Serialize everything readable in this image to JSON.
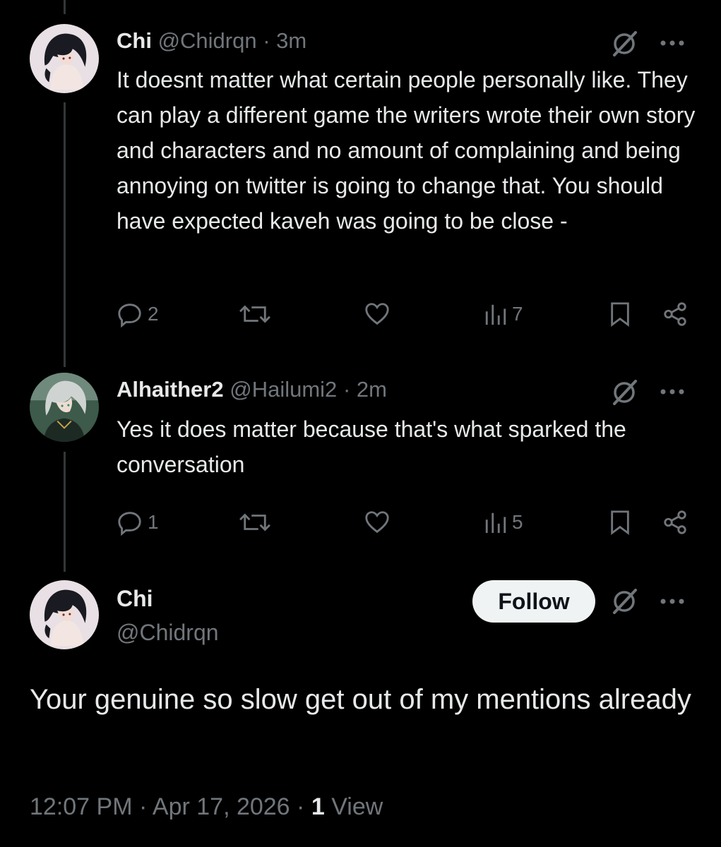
{
  "replies": [
    {
      "name": "Chi",
      "handle": "@Chidrqn",
      "separator": "·",
      "time": "3m",
      "text": "It doesnt matter what certain people personally like. They can play a different game the writers wrote their own story and characters and no amount of complaining and being annoying on twitter is going to change that. You should have expected kaveh was going to be close -",
      "reply_count": "2",
      "views": "7",
      "icons": [
        "reply-icon",
        "retweet-icon",
        "like-icon",
        "views-icon",
        "bookmark-icon",
        "share-icon",
        "grok-icon",
        "more-icon"
      ]
    },
    {
      "name": "Alhaither2",
      "handle": "@Hailumi2",
      "separator": "·",
      "time": "2m",
      "text": "Yes it does matter because that's what sparked the conversation",
      "reply_count": "1",
      "views": "5",
      "icons": [
        "reply-icon",
        "retweet-icon",
        "like-icon",
        "views-icon",
        "bookmark-icon",
        "share-icon",
        "grok-icon",
        "more-icon"
      ]
    }
  ],
  "main_tweet": {
    "name": "Chi",
    "handle": "@Chidrqn",
    "follow_label": "Follow",
    "text": "Your genuine so slow get out of my mentions already",
    "time": "12:07 PM",
    "separator": "·",
    "date": "Apr 17, 2026",
    "views_count": "1",
    "views_label": "View"
  },
  "colors": {
    "background": "#000000",
    "text": "#e7e9ea",
    "muted": "#71767b",
    "thread_line": "#333639",
    "follow_bg": "#eff3f4"
  }
}
